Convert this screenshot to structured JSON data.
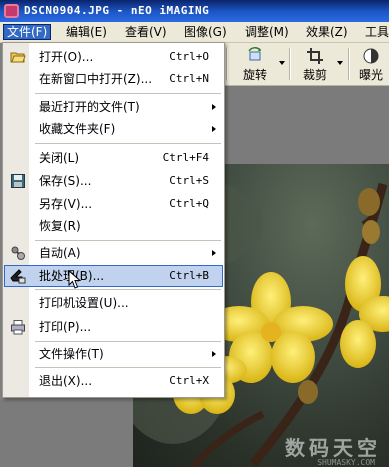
{
  "window": {
    "title": "DSCN0904.JPG - nEO iMAGING"
  },
  "menubar": {
    "items": [
      "文件(F)",
      "编辑(E)",
      "查看(V)",
      "图像(G)",
      "调整(M)",
      "效果(Z)",
      "工具"
    ],
    "active_index": 0
  },
  "toolbar": {
    "rotate_label": "旋转",
    "crop_label": "裁剪",
    "exposure_label": "曝光"
  },
  "file_menu": {
    "items": [
      {
        "label": "打开(O)...",
        "shortcut": "Ctrl+O",
        "icon": "open-folder-icon"
      },
      {
        "label": "在新窗口中打开(Z)...",
        "shortcut": "Ctrl+N"
      },
      {
        "label": "最近打开的文件(T)",
        "submenu": true
      },
      {
        "label": "收藏文件夹(F)",
        "submenu": true
      },
      {
        "label": "关闭(L)",
        "shortcut": "Ctrl+F4"
      },
      {
        "label": "保存(S)...",
        "shortcut": "Ctrl+S",
        "icon": "floppy-disk-icon"
      },
      {
        "label": "另存(V)...",
        "shortcut": "Ctrl+Q"
      },
      {
        "label": "恢复(R)"
      },
      {
        "label": "自动(A)",
        "submenu": true,
        "icon": "automation-icon"
      },
      {
        "label": "批处理(B)...",
        "shortcut": "Ctrl+B",
        "icon": "batch-icon",
        "highlighted": true
      },
      {
        "label": "打印机设置(U)..."
      },
      {
        "label": "打印(P)...",
        "icon": "printer-icon"
      },
      {
        "label": "文件操作(T)",
        "submenu": true
      },
      {
        "label": "退出(X)...",
        "shortcut": "Ctrl+X"
      }
    ]
  },
  "photo": {
    "watermark": "数码天空",
    "watermark_sub": "SHUMASKY.COM"
  },
  "colors": {
    "title_bar": "#0a246a",
    "menu_highlight": "#c1d2ee",
    "menubar_active": "#316ac5"
  }
}
